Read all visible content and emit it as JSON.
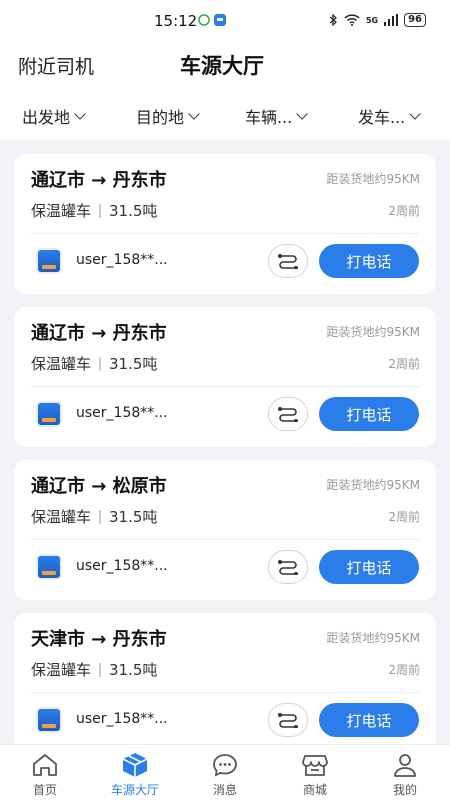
{
  "status_bar": {
    "time": "15:12",
    "battery": "96",
    "network": "5G"
  },
  "header": {
    "nearby_label": "附近司机",
    "title": "车源大厅"
  },
  "filters": [
    {
      "label": "出发地"
    },
    {
      "label": "目的地"
    },
    {
      "label": "车辆..."
    },
    {
      "label": "发车..."
    }
  ],
  "cards": [
    {
      "route": "通辽市 → 丹东市",
      "distance": "距装货地约95KM",
      "truck_type": "保温罐车",
      "tonnage": "31.5吨",
      "posted": "2周前",
      "user": "user_158**...",
      "call_label": "打电话"
    },
    {
      "route": "通辽市 → 丹东市",
      "distance": "距装货地约95KM",
      "truck_type": "保温罐车",
      "tonnage": "31.5吨",
      "posted": "2周前",
      "user": "user_158**...",
      "call_label": "打电话"
    },
    {
      "route": "通辽市 → 松原市",
      "distance": "距装货地约95KM",
      "truck_type": "保温罐车",
      "tonnage": "31.5吨",
      "posted": "2周前",
      "user": "user_158**...",
      "call_label": "打电话"
    },
    {
      "route": "天津市 → 丹东市",
      "distance": "距装货地约95KM",
      "truck_type": "保温罐车",
      "tonnage": "31.5吨",
      "posted": "2周前",
      "user": "user_158**...",
      "call_label": "打电话"
    }
  ],
  "tabbar": [
    {
      "label": "首页",
      "icon": "home-icon"
    },
    {
      "label": "车源大厅",
      "icon": "box-icon",
      "active": true
    },
    {
      "label": "消息",
      "icon": "message-icon"
    },
    {
      "label": "商城",
      "icon": "shop-icon"
    },
    {
      "label": "我的",
      "icon": "user-icon"
    }
  ],
  "colors": {
    "accent": "#2b7de9",
    "background": "#f2f3f6",
    "muted_text": "#999999"
  }
}
